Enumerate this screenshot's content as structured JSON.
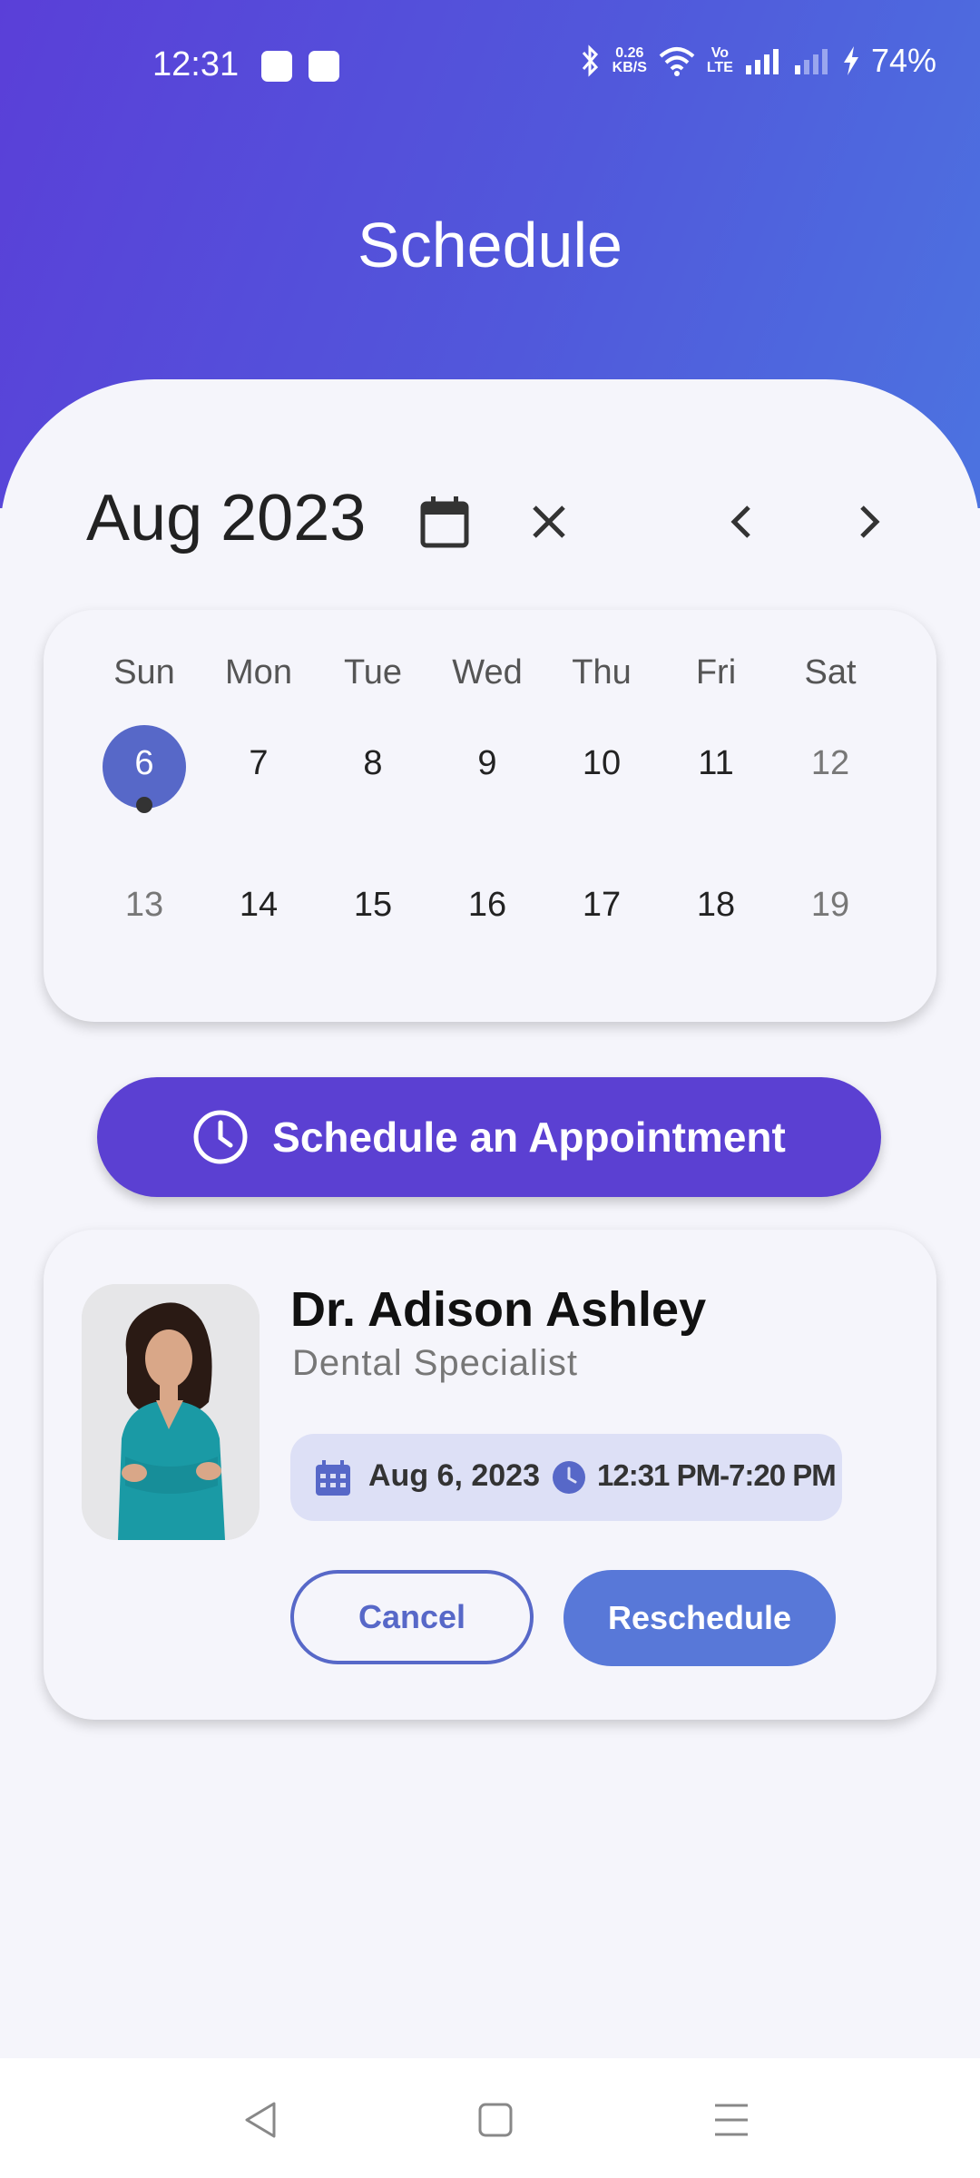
{
  "status_bar": {
    "time": "12:31",
    "net_speed_value": "0.26",
    "net_speed_unit": "KB/S",
    "vo_label": "Vo",
    "lte_label": "LTE",
    "battery": "74%"
  },
  "page": {
    "title": "Schedule"
  },
  "calendar": {
    "month_label": "Aug 2023",
    "weekdays": [
      "Sun",
      "Mon",
      "Tue",
      "Wed",
      "Thu",
      "Fri",
      "Sat"
    ],
    "week1": [
      "6",
      "7",
      "8",
      "9",
      "10",
      "11",
      "12"
    ],
    "week2": [
      "13",
      "14",
      "15",
      "16",
      "17",
      "18",
      "19"
    ],
    "selected_day": "6"
  },
  "appointment_button": {
    "label": "Schedule an Appointment"
  },
  "doctor_card": {
    "name": "Dr. Adison Ashley",
    "specialty": "Dental Specialist",
    "date": "Aug 6, 2023",
    "time_range": "12:31 PM-7:20 PM",
    "cancel_label": "Cancel",
    "reschedule_label": "Reschedule"
  },
  "colors": {
    "accent": "#5b40d2",
    "selected_day": "#5768c8",
    "reschedule": "#5878d8",
    "pill_bg": "#dde0f6"
  },
  "icons": {
    "calendar_picker": "calendar-icon",
    "clear": "close-icon",
    "prev": "chevron-left-icon",
    "next": "chevron-right-icon",
    "clock": "clock-icon"
  }
}
